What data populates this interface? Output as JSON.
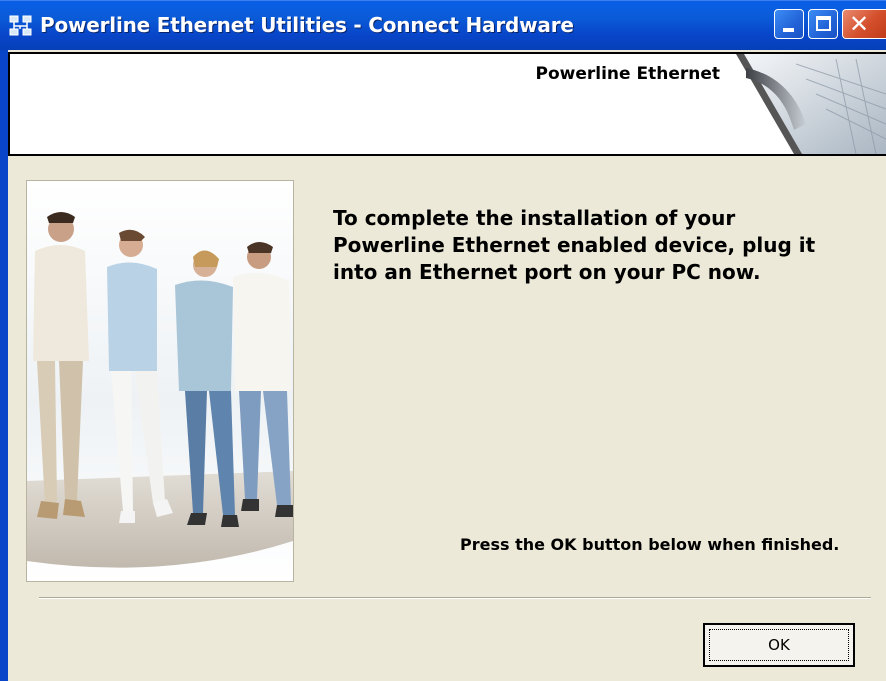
{
  "window": {
    "title": "Powerline Ethernet Utilities - Connect Hardware",
    "icon": "network-icon",
    "controls": [
      "minimize",
      "maximize",
      "close"
    ]
  },
  "banner": {
    "title": "Powerline Ethernet"
  },
  "content": {
    "instruction": "To complete the installation of your Powerline Ethernet enabled device, plug it into an Ethernet port on your PC now.",
    "finish_note": "Press the OK button below when finished."
  },
  "buttons": {
    "ok_label": "OK"
  },
  "colors": {
    "titlebar": "#0a5bd8",
    "dialog_bg": "#ece9d8",
    "close_button": "#d4502c"
  }
}
